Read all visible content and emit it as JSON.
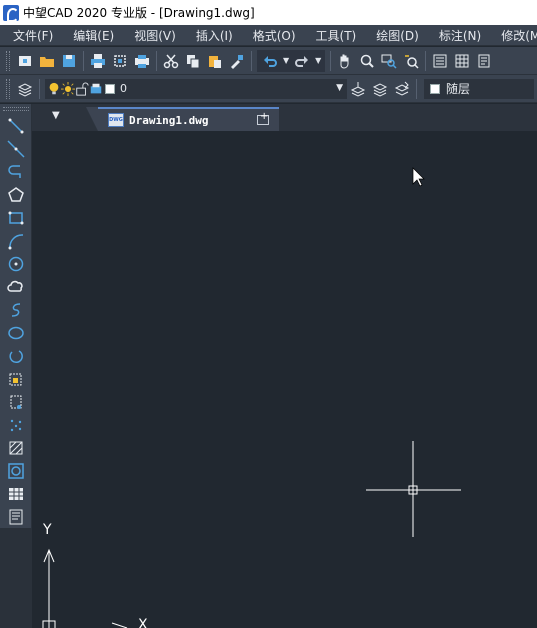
{
  "window": {
    "title": "中望CAD 2020 专业版 - [Drawing1.dwg]"
  },
  "menu": [
    "文件(F)",
    "编辑(E)",
    "视图(V)",
    "插入(I)",
    "格式(O)",
    "工具(T)",
    "绘图(D)",
    "标注(N)",
    "修改(M)"
  ],
  "layer_toolbar": {
    "current_layer": "0",
    "color_value": "随层"
  },
  "document_tabs": [
    {
      "label": "Drawing1.dwg",
      "icon": "dwg-file-icon"
    }
  ],
  "ucs": {
    "y_label": "Y",
    "x_label": "X"
  },
  "colors": {
    "canvas": "#212830",
    "chrome": "#3a4350",
    "accent": "#5a86c8",
    "icon_blue": "#4fa3e0",
    "icon_yellow": "#f2c230"
  }
}
